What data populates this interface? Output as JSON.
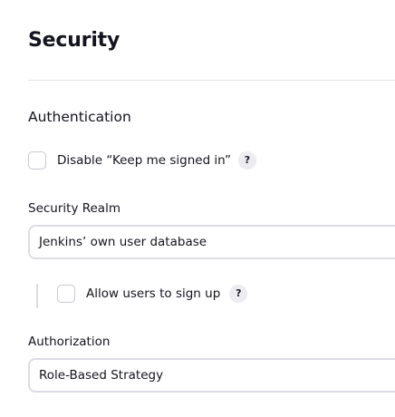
{
  "page": {
    "title": "Security"
  },
  "authentication": {
    "heading": "Authentication",
    "disable_keep_signed_in_label": "Disable “Keep me signed in”",
    "disable_keep_signed_in_checked": false,
    "help_label": "?"
  },
  "security_realm": {
    "label": "Security Realm",
    "selected": "Jenkins’ own user database",
    "allow_signup_label": "Allow users to sign up",
    "allow_signup_checked": false,
    "help_label": "?"
  },
  "authorization": {
    "label": "Authorization",
    "selected": "Role-Based Strategy"
  },
  "colors": {
    "text": "#14141f",
    "border": "#dcdce4",
    "help_bg": "#ececf1",
    "divider": "#e6e6ea"
  },
  "icons": {
    "help": "question-mark-icon"
  }
}
